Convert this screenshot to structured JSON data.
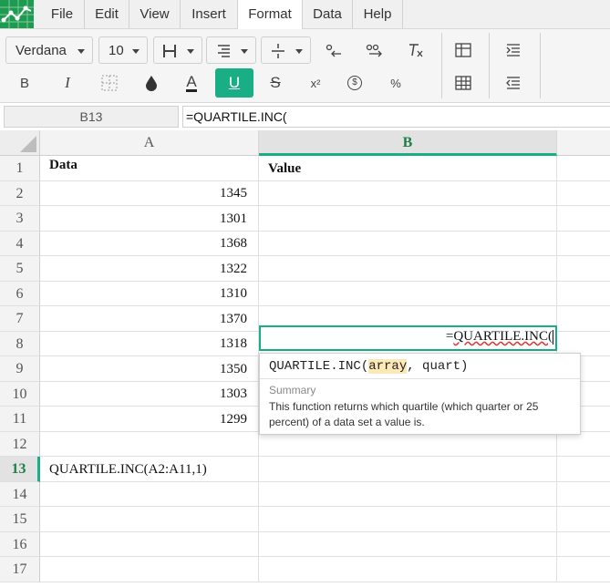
{
  "menu": [
    "File",
    "Edit",
    "View",
    "Insert",
    "Format",
    "Data",
    "Help"
  ],
  "menu_active": "Format",
  "accent": "#1aae84",
  "toolbar": {
    "font": "Verdana",
    "size": "10",
    "bold": "B",
    "italic": "I",
    "font_color": "A",
    "underline": "U",
    "strike": "S",
    "superscript": "x²",
    "currency": "$",
    "percent": "%"
  },
  "formula_bar": {
    "cell_ref": "B13",
    "formula": "=QUARTILE.INC("
  },
  "columns": [
    "A",
    "B"
  ],
  "rows": [
    {
      "num": "1",
      "a": "Data",
      "b": "Value"
    },
    {
      "num": "2",
      "a": "1345",
      "b": ""
    },
    {
      "num": "3",
      "a": "1301",
      "b": ""
    },
    {
      "num": "4",
      "a": "1368",
      "b": ""
    },
    {
      "num": "5",
      "a": "1322",
      "b": ""
    },
    {
      "num": "6",
      "a": "1310",
      "b": ""
    },
    {
      "num": "7",
      "a": "1370",
      "b": ""
    },
    {
      "num": "8",
      "a": "1318",
      "b": ""
    },
    {
      "num": "9",
      "a": "1350",
      "b": ""
    },
    {
      "num": "10",
      "a": "1303",
      "b": ""
    },
    {
      "num": "11",
      "a": "1299",
      "b": ""
    },
    {
      "num": "12",
      "a": "",
      "b": ""
    },
    {
      "num": "13",
      "a": "QUARTILE.INC(A2:A11,1)",
      "b": ""
    },
    {
      "num": "14",
      "a": "",
      "b": ""
    },
    {
      "num": "15",
      "a": "",
      "b": ""
    },
    {
      "num": "16",
      "a": "",
      "b": ""
    },
    {
      "num": "17",
      "a": "",
      "b": ""
    }
  ],
  "editing": {
    "prefix": "=",
    "fn": "QUARTILE.INC",
    "rest": "("
  },
  "tooltip": {
    "fn": "QUARTILE.INC(",
    "arg_current": "array",
    "arg_rest": ", quart)",
    "summary_label": "Summary",
    "description": "This function returns which quartile (which quarter or 25 percent) of a data set a value is."
  }
}
